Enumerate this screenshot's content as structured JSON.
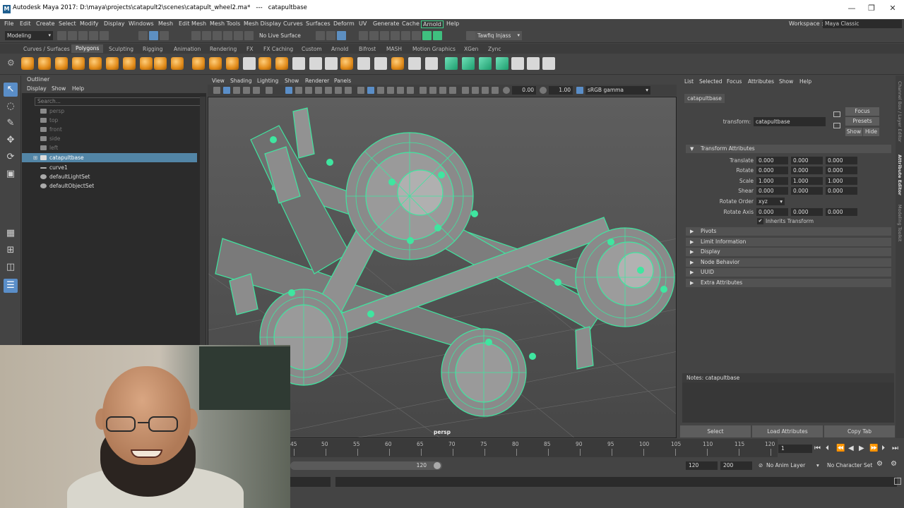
{
  "titlebar": {
    "title": "Autodesk Maya 2017: D:\\maya\\projects\\catapult2\\scenes\\catapult_wheel2.ma*   ---   catapultbase",
    "logo": "M"
  },
  "menubar": {
    "items": [
      "File",
      "Edit",
      "Create",
      "Select",
      "Modify",
      "Display",
      "Windows",
      "Mesh",
      "Edit Mesh",
      "Mesh Tools",
      "Mesh Display",
      "Curves",
      "Surfaces",
      "Deform",
      "UV",
      "Generate",
      "Cache",
      "Arnold",
      "Help"
    ],
    "workspace_label": "Workspace :",
    "workspace_value": "Maya Classic"
  },
  "statusline": {
    "mode": "Modeling",
    "live_surface": "No Live Surface",
    "user": "Tawfiq Injass"
  },
  "shelf": {
    "tabs": [
      "Curves / Surfaces",
      "Polygons",
      "Sculpting",
      "Rigging",
      "Animation",
      "Rendering",
      "FX",
      "FX Caching",
      "Custom",
      "Arnold",
      "Bifrost",
      "MASH",
      "Motion Graphics",
      "XGen",
      "Zync"
    ],
    "active_tab": "Polygons"
  },
  "outliner": {
    "title": "Outliner",
    "menus": [
      "Display",
      "Show",
      "Help"
    ],
    "search_placeholder": "Search...",
    "items": [
      {
        "label": "persp",
        "dim": true
      },
      {
        "label": "top",
        "dim": true
      },
      {
        "label": "front",
        "dim": true
      },
      {
        "label": "side",
        "dim": true
      },
      {
        "label": "left",
        "dim": true
      },
      {
        "label": "catapultbase",
        "selected": true
      },
      {
        "label": "curve1"
      },
      {
        "label": "defaultLightSet"
      },
      {
        "label": "defaultObjectSet"
      }
    ]
  },
  "viewport": {
    "menus": [
      "View",
      "Shading",
      "Lighting",
      "Show",
      "Renderer",
      "Panels"
    ],
    "exposure": "0.00",
    "gamma": "1.00",
    "color_space": "sRGB gamma",
    "camera": "persp",
    "wire_color": "#3fe6a0"
  },
  "attribute_editor": {
    "menus": [
      "List",
      "Selected",
      "Focus",
      "Attributes",
      "Show",
      "Help"
    ],
    "tab": "catapultbase",
    "transform_label": "transform:",
    "transform_value": "catapultbase",
    "focus_label": "Focus",
    "presets_label": "Presets",
    "show_label": "Show",
    "hide_label": "Hide",
    "section": "Transform Attributes",
    "translate": {
      "label": "Translate",
      "values": [
        "0.000",
        "0.000",
        "0.000"
      ]
    },
    "rotate": {
      "label": "Rotate",
      "values": [
        "0.000",
        "0.000",
        "0.000"
      ]
    },
    "scale": {
      "label": "Scale",
      "values": [
        "1.000",
        "1.000",
        "1.000"
      ]
    },
    "shear": {
      "label": "Shear",
      "values": [
        "0.000",
        "0.000",
        "0.000"
      ]
    },
    "rotate_order": {
      "label": "Rotate Order",
      "value": "xyz"
    },
    "rotate_axis": {
      "label": "Rotate Axis",
      "values": [
        "0.000",
        "0.000",
        "0.000"
      ]
    },
    "inherits": "Inherits Transform",
    "collapsed_sections": [
      "Pivots",
      "Limit Information",
      "Display",
      "Node Behavior",
      "UUID",
      "Extra Attributes"
    ],
    "notes_label": "Notes:  catapultbase",
    "buttons": [
      "Select",
      "Load Attributes",
      "Copy Tab"
    ],
    "side_tabs": [
      "Channel Box / Layer Editor",
      "Attribute Editor",
      "Modeling Toolkit"
    ]
  },
  "timeslider": {
    "ticks": [
      "45",
      "50",
      "55",
      "60",
      "65",
      "70",
      "75",
      "80",
      "85",
      "90",
      "95",
      "100",
      "105",
      "110",
      "115",
      "120"
    ],
    "current_frame": "1"
  },
  "rangeslider": {
    "end_value": "120",
    "range_end": "120",
    "anim_end": "200",
    "anim_layer": "No Anim Layer",
    "char_set": "No Character Set"
  }
}
